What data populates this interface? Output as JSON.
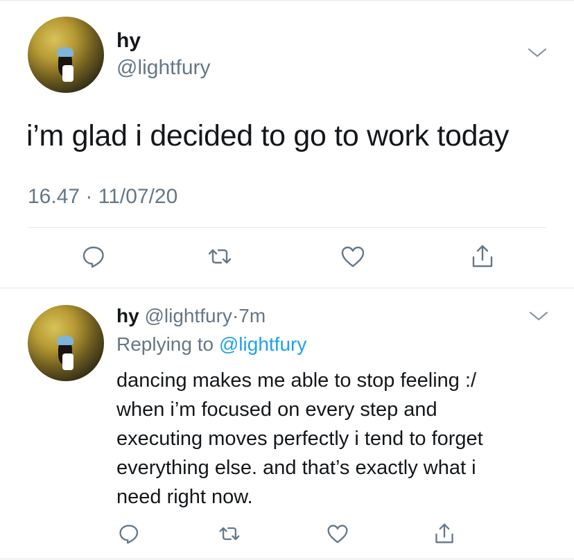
{
  "tweet": {
    "display_name": "hy",
    "handle": "@lightfury",
    "text": "i’m glad i decided to go to work today",
    "timestamp": "16.47 · 11/07/20",
    "actions": [
      "reply-icon",
      "retweet-icon",
      "like-icon",
      "share-icon"
    ]
  },
  "reply": {
    "display_name": "hy",
    "handle": "@lightfury",
    "separator": "·",
    "time": "7m",
    "replying_prefix": "Replying to",
    "replying_handle": "@lightfury",
    "lines": [
      "dancing makes me able to stop feeling :/",
      "when i’m focused on every step and",
      "executing moves perfectly i tend to forget",
      "everything else. and that’s exactly what i",
      "need right now."
    ],
    "actions": [
      "reply-icon",
      "retweet-icon",
      "like-icon",
      "share-icon"
    ]
  },
  "colors": {
    "text": "#14171a",
    "muted": "#657786",
    "link": "#1da1f2",
    "divider": "#e1e8ed",
    "icon": "#657786"
  }
}
